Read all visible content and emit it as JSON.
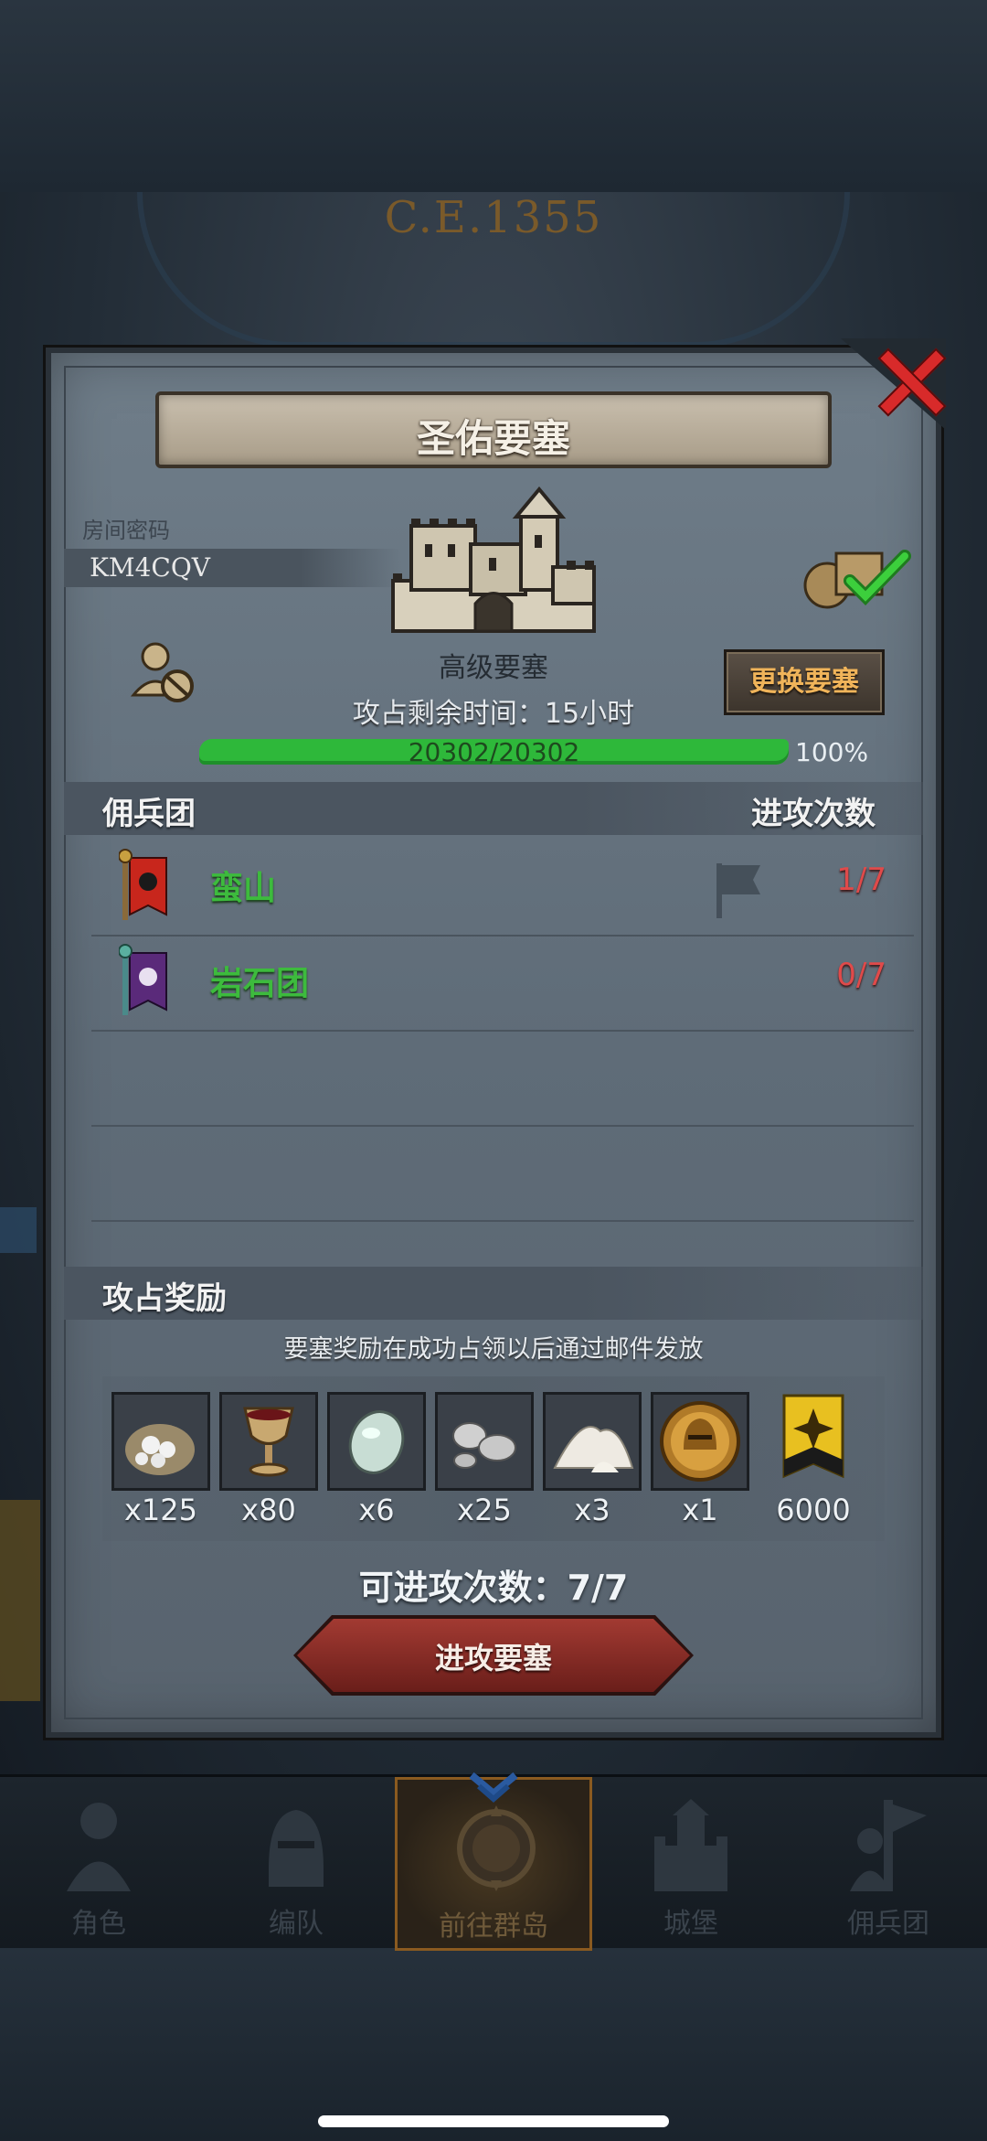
{
  "background": {
    "era_label": "C.E.1355"
  },
  "dialog": {
    "title": "圣佑要塞",
    "room_code_label": "房间密码",
    "room_code": "KM4CQV",
    "fortress_type": "高级要塞",
    "change_button": "更换要塞",
    "time_left": "攻占剩余时间：15小时",
    "hp": {
      "text": "20302/20302",
      "percent_label": "100%",
      "fraction": 1.0
    },
    "mercenaries": {
      "section_title": "佣兵团",
      "count_header": "进攻次数",
      "rows": [
        {
          "name": "蛮山",
          "attacks": "1/7",
          "banner_color": "#c8261c",
          "emblem": "black-sun"
        },
        {
          "name": "岩石团",
          "attacks": "0/7",
          "banner_color": "#5a2a7a",
          "emblem": "white-star"
        }
      ]
    },
    "rewards": {
      "section_title": "攻占奖励",
      "note": "要塞奖励在成功占领以后通过邮件发放",
      "items": [
        {
          "icon": "salt-sack-icon",
          "qty": "x125"
        },
        {
          "icon": "goblet-icon",
          "qty": "x80"
        },
        {
          "icon": "gem-stone-icon",
          "qty": "x6"
        },
        {
          "icon": "silver-ore-icon",
          "qty": "x25"
        },
        {
          "icon": "white-powder-icon",
          "qty": "x3"
        },
        {
          "icon": "golden-helmet-icon",
          "qty": "x1"
        },
        {
          "icon": "honor-banner-icon",
          "qty": "6000"
        }
      ]
    },
    "attacks_left": "可进攻次数：7/7",
    "attack_button": "进攻要塞"
  },
  "nav": {
    "items": [
      {
        "label": "角色",
        "icon": "knight-icon"
      },
      {
        "label": "编队",
        "icon": "helmet-icon"
      },
      {
        "label": "前往群岛",
        "icon": "compass-icon",
        "active": true
      },
      {
        "label": "城堡",
        "icon": "castle-icon"
      },
      {
        "label": "佣兵团",
        "icon": "mercenary-icon"
      }
    ]
  },
  "colors": {
    "merc_name": "#3dbb3d",
    "attack_count": "#e04a4a",
    "hp_bar": "#2eb83a",
    "change_button_text": "#f0b45a",
    "attack_button": "#a23a32"
  }
}
